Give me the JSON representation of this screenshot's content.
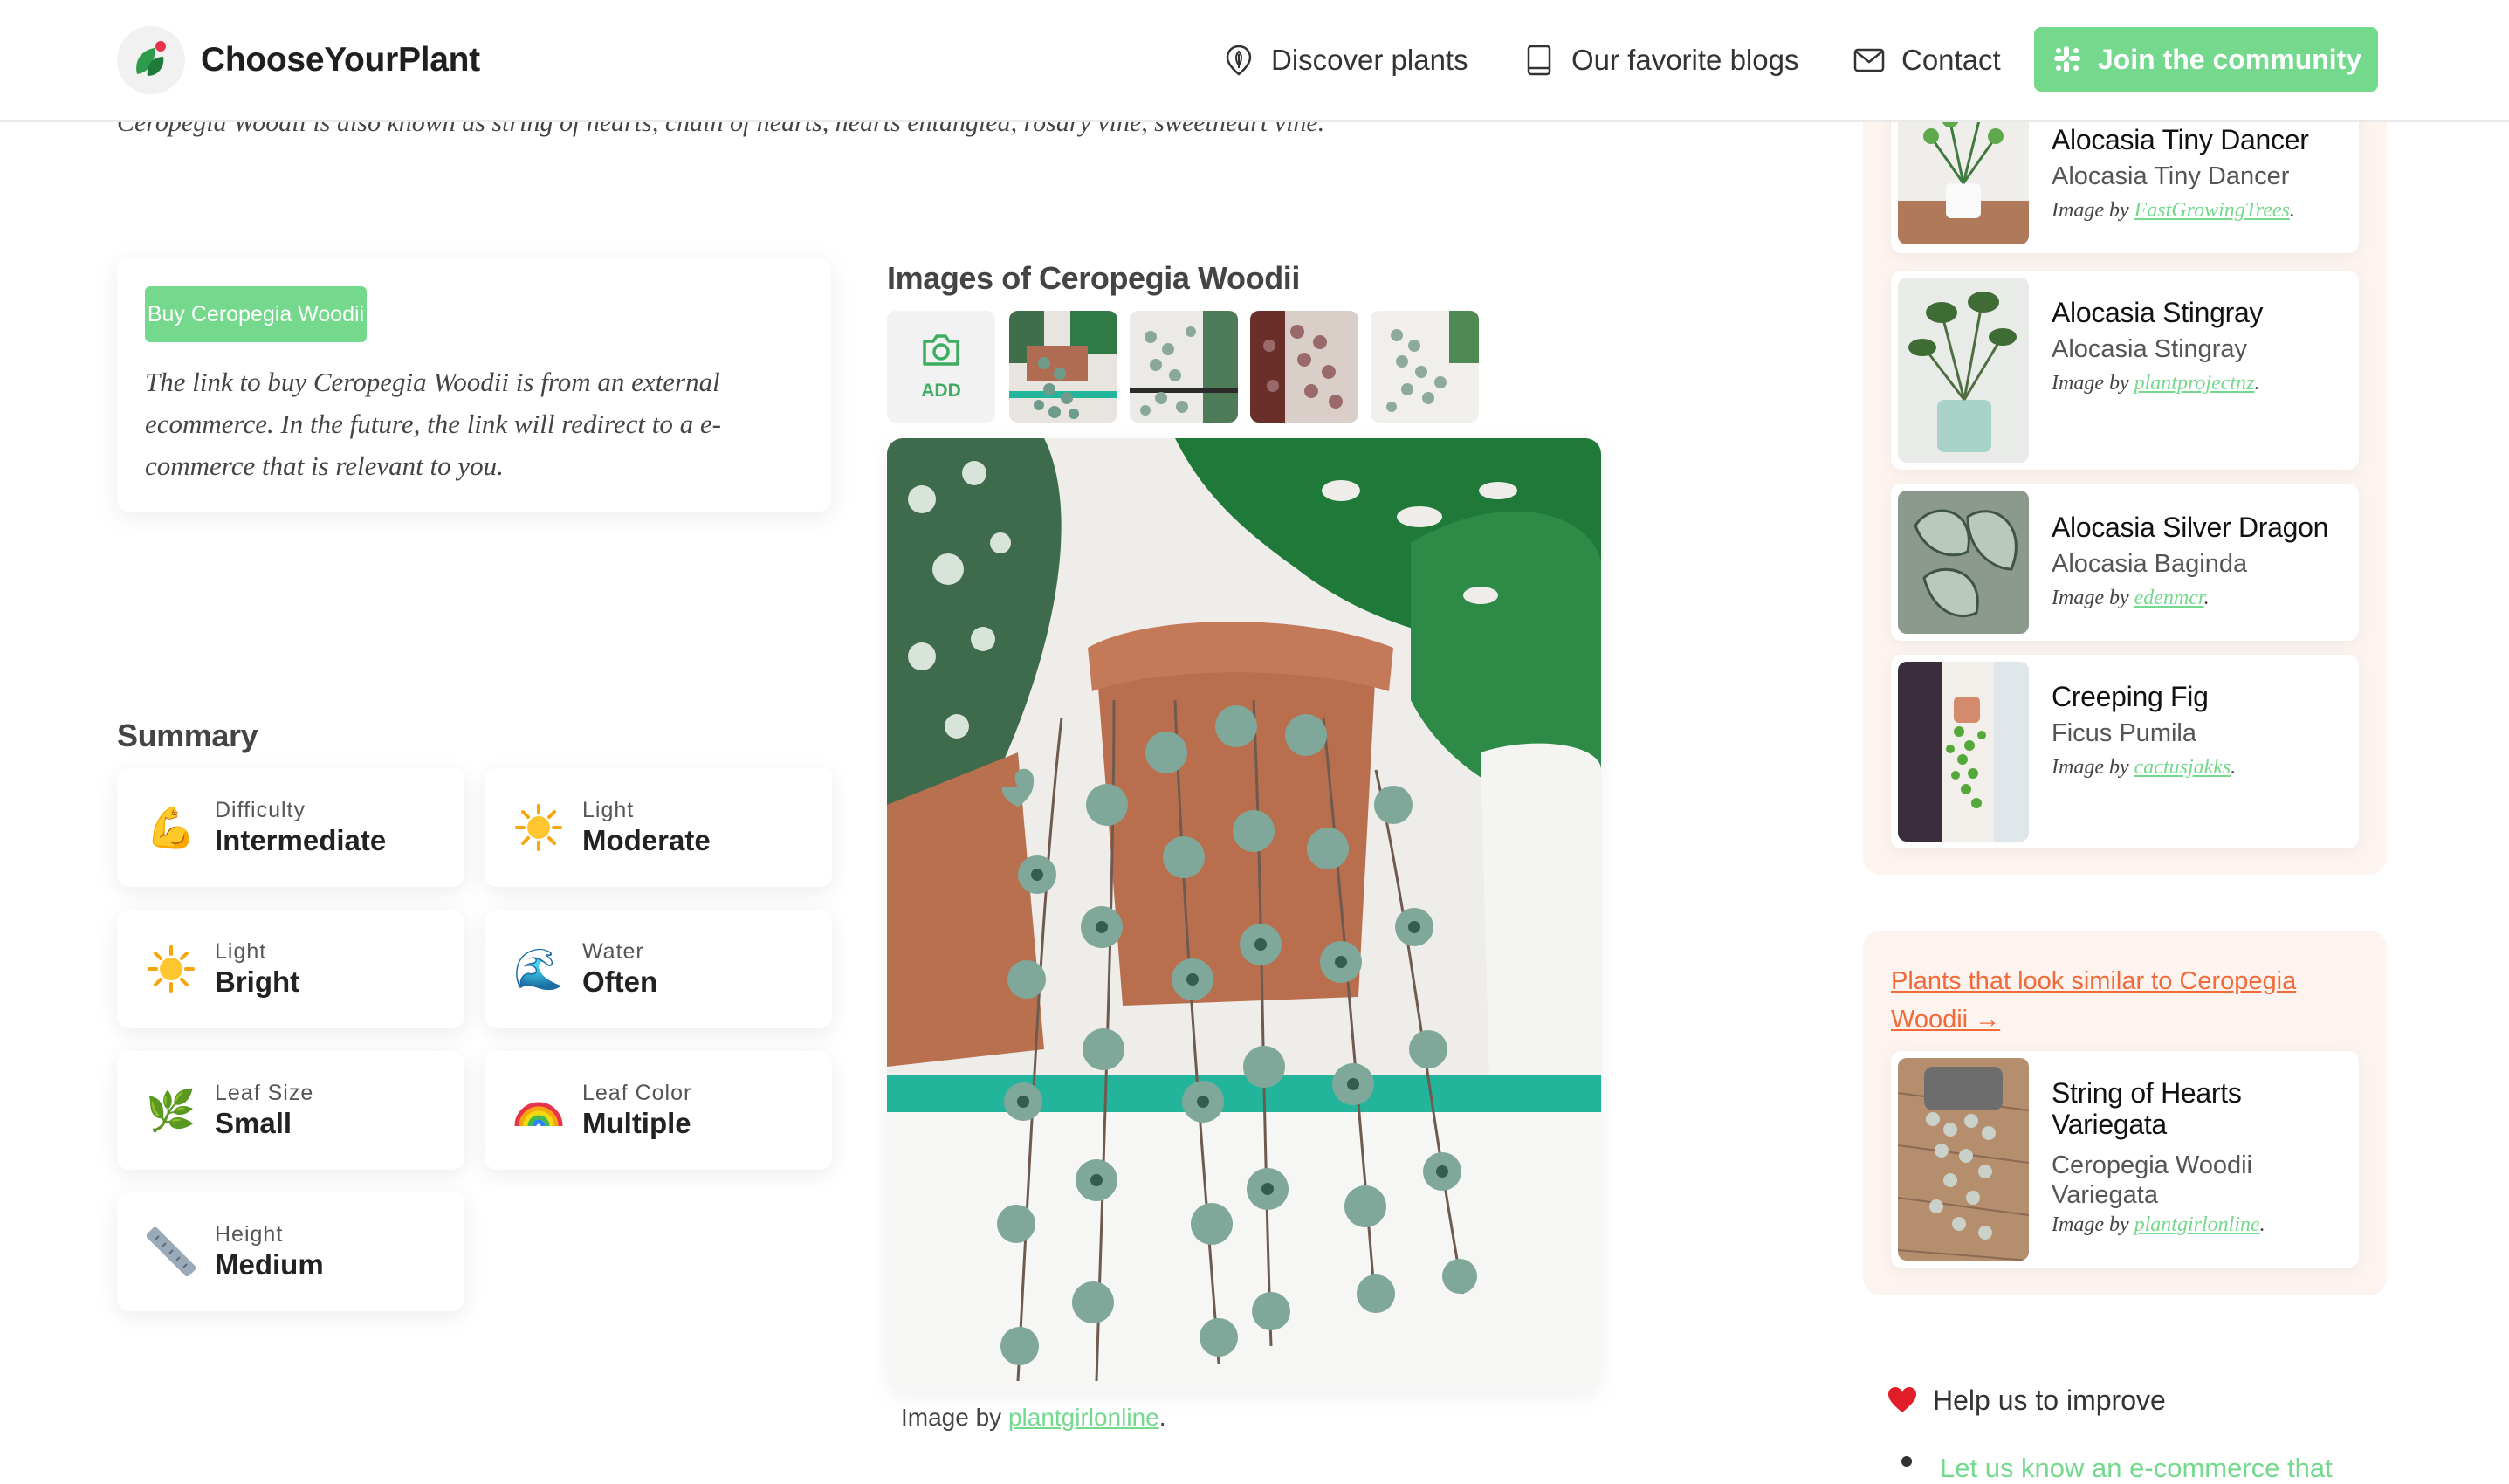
{
  "brand": {
    "name": "ChooseYourPlant",
    "accent": "#74d88d",
    "accent_dark": "#3dae5f",
    "logo_color": "#2e9b4d",
    "highlight": "#f26a3a"
  },
  "nav": {
    "discover": {
      "label": "Discover plants",
      "icon": "pin-leaf-icon"
    },
    "blogs": {
      "label": "Our favorite blogs",
      "icon": "book-icon"
    },
    "contact": {
      "label": "Contact",
      "icon": "mail-icon"
    },
    "join": {
      "label": "Join the community",
      "icon": "slack-icon"
    }
  },
  "intro_text": "Ceropegia Woodii is also known as string of hearts, chain of hearts, hearts entangled, rosary vine, sweetheart vine.",
  "buy": {
    "button_label": "Buy Ceropegia Woodii",
    "description": "The link to buy Ceropegia Woodii is from an external ecommerce. In the future, the link will redirect to a e-commerce that is relevant to you."
  },
  "summary": {
    "title": "Summary",
    "items": [
      {
        "emoji": "💪",
        "label": "Difficulty",
        "value": "Intermediate"
      },
      {
        "emoji": "☀️",
        "label": "Light",
        "value": "Moderate"
      },
      {
        "emoji": "☀️",
        "label": "Light",
        "value": "Bright"
      },
      {
        "emoji": "🌊",
        "label": "Water",
        "value": "Often"
      },
      {
        "emoji": "🌿",
        "label": "Leaf Size",
        "value": "Small"
      },
      {
        "emoji": "🌈",
        "label": "Leaf Color",
        "value": "Multiple"
      },
      {
        "emoji": "📏",
        "label": "Height",
        "value": "Medium"
      }
    ]
  },
  "images": {
    "title": "Images of Ceropegia Woodii",
    "add_label": "ADD",
    "caption_prefix": "Image by ",
    "caption_author": "plantgirlonline",
    "caption_suffix": "."
  },
  "plants": [
    {
      "name": "Alocasia Tiny Dancer",
      "scientific": "Alocasia Tiny Dancer",
      "credit_prefix": "Image by ",
      "credit_author": "FastGrowingTrees",
      "credit_suffix": "."
    },
    {
      "name": "Alocasia Stingray",
      "scientific": "Alocasia Stingray",
      "credit_prefix": "Image by ",
      "credit_author": "plantprojectnz",
      "credit_suffix": "."
    },
    {
      "name": "Alocasia Silver Dragon",
      "scientific": "Alocasia Baginda",
      "credit_prefix": "Image by ",
      "credit_author": "edenmcr",
      "credit_suffix": "."
    },
    {
      "name": "Creeping Fig",
      "scientific": "Ficus Pumila",
      "credit_prefix": "Image by ",
      "credit_author": "cactusjakks",
      "credit_suffix": "."
    }
  ],
  "similar": {
    "link": "Plants that look similar to Ceropegia Woodii →",
    "plant": {
      "name": "String of Hearts Variegata",
      "scientific": "Ceropegia Woodii Variegata",
      "credit_prefix": "Image by ",
      "credit_author": "plantgirlonline",
      "credit_suffix": "."
    }
  },
  "help": {
    "title": "Help us to improve",
    "link": "Let us know an e-commerce that"
  }
}
